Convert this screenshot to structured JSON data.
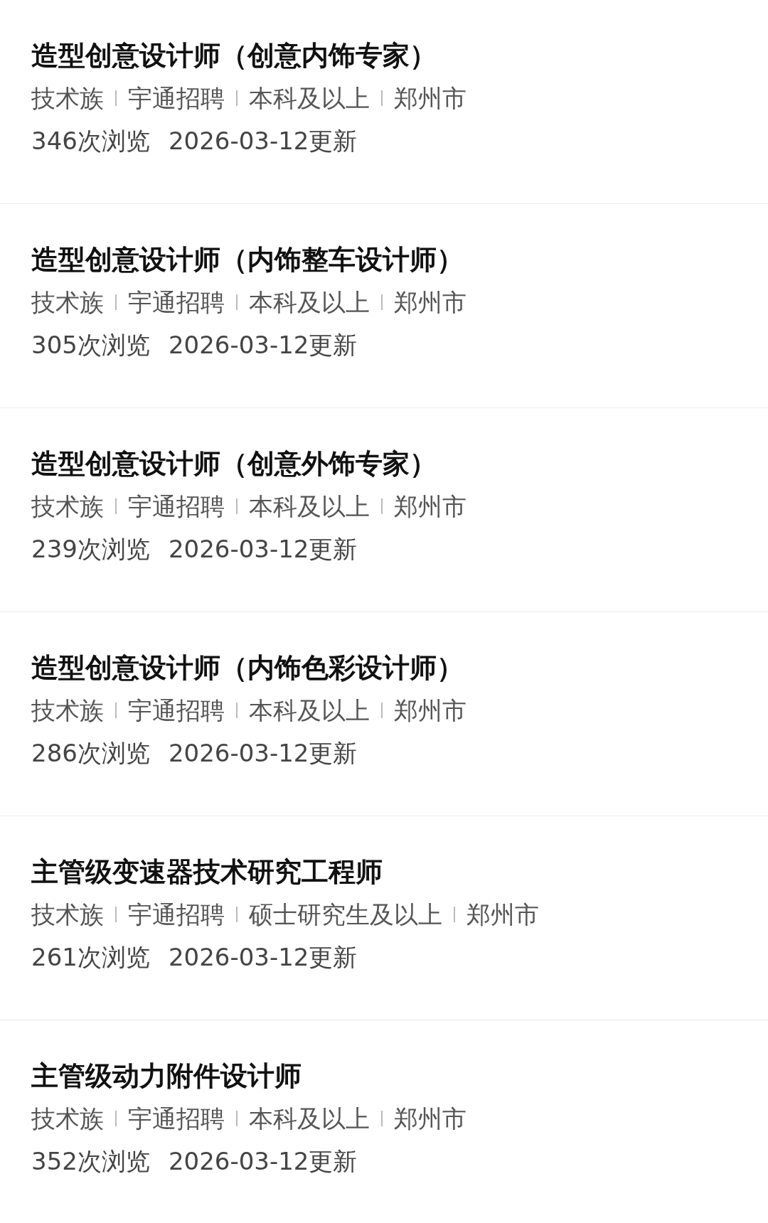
{
  "jobs": [
    {
      "title": "造型创意设计师（创意内饰专家）",
      "tags": [
        "技术族",
        "宇通招聘",
        "本科及以上",
        "郑州市"
      ],
      "views": "346次浏览",
      "updated": "2026-03-12更新"
    },
    {
      "title": "造型创意设计师（内饰整车设计师）",
      "tags": [
        "技术族",
        "宇通招聘",
        "本科及以上",
        "郑州市"
      ],
      "views": "305次浏览",
      "updated": "2026-03-12更新"
    },
    {
      "title": "造型创意设计师（创意外饰专家）",
      "tags": [
        "技术族",
        "宇通招聘",
        "本科及以上",
        "郑州市"
      ],
      "views": "239次浏览",
      "updated": "2026-03-12更新"
    },
    {
      "title": "造型创意设计师（内饰色彩设计师）",
      "tags": [
        "技术族",
        "宇通招聘",
        "本科及以上",
        "郑州市"
      ],
      "views": "286次浏览",
      "updated": "2026-03-12更新"
    },
    {
      "title": "主管级变速器技术研究工程师",
      "tags": [
        "技术族",
        "宇通招聘",
        "硕士研究生及以上",
        "郑州市"
      ],
      "views": "261次浏览",
      "updated": "2026-03-12更新"
    },
    {
      "title": "主管级动力附件设计师",
      "tags": [
        "技术族",
        "宇通招聘",
        "本科及以上",
        "郑州市"
      ],
      "views": "352次浏览",
      "updated": "2026-03-12更新"
    }
  ]
}
